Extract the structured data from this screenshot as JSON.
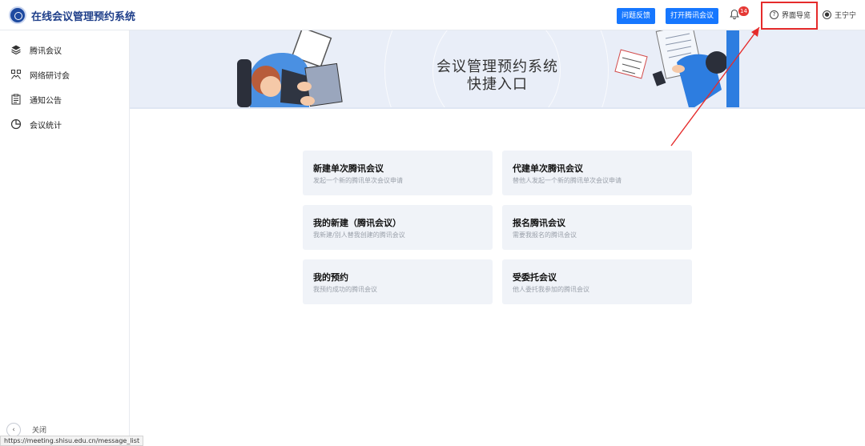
{
  "header": {
    "app_title": "在线会议管理预约系统",
    "feedback_button": "问题反馈",
    "open_meeting_button": "打开腾讯会议",
    "notification_count": "14",
    "guide_label": "界面导览",
    "user_name": "王宁宁"
  },
  "sidebar": {
    "items": [
      {
        "label": "腾讯会议",
        "icon": "layers-icon"
      },
      {
        "label": "网络研讨会",
        "icon": "webinar-icon"
      },
      {
        "label": "通知公告",
        "icon": "clipboard-icon"
      },
      {
        "label": "会议统计",
        "icon": "pie-chart-icon"
      }
    ],
    "collapse_label": "关闭"
  },
  "banner": {
    "title_line1": "会议管理预约系统",
    "title_line2": "快捷入口"
  },
  "cards": [
    {
      "title": "新建单次腾讯会议",
      "desc": "发起一个新的腾讯单次会议申请"
    },
    {
      "title": "代建单次腾讯会议",
      "desc": "替他人发起一个新的腾讯单次会议申请"
    },
    {
      "title": "我的新建（腾讯会议）",
      "desc": "我新建/别人替我创建的腾讯会议"
    },
    {
      "title": "报名腾讯会议",
      "desc": "需要我报名的腾讯会议"
    },
    {
      "title": "我的预约",
      "desc": "我预约成功的腾讯会议"
    },
    {
      "title": "受委托会议",
      "desc": "他人委托我参加的腾讯会议"
    }
  ],
  "status_bar": {
    "url": "https://meeting.shisu.edu.cn/message_list"
  },
  "colors": {
    "primary": "#1677ff",
    "highlight": "#e52b2b",
    "badge": "#e53935",
    "title": "#1f3f8a"
  }
}
